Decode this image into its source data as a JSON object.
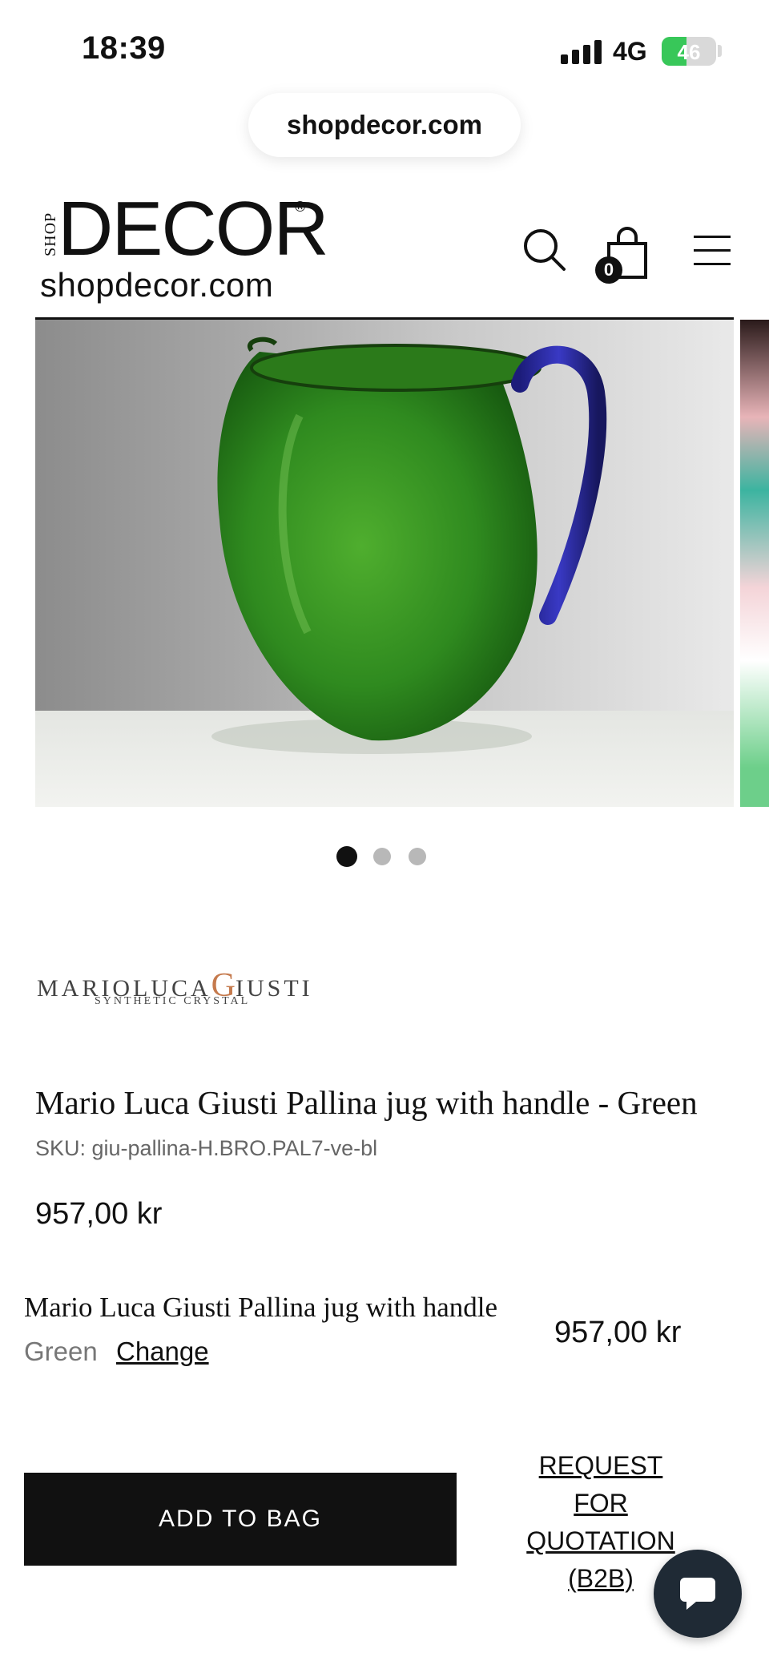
{
  "status_bar": {
    "time": "18:39",
    "network": "4G",
    "battery": "46",
    "battery_level": 0.46
  },
  "browser": {
    "url": "shopdecor.com"
  },
  "header": {
    "logo_shop": "SHOP",
    "logo_name": "DECOR",
    "logo_reg": "®",
    "logo_domain": "shopdecor.com",
    "bag_count": "0",
    "icons": [
      "search-icon",
      "bag-icon",
      "menu-icon"
    ]
  },
  "gallery": {
    "image_count": 3,
    "active_index": 0
  },
  "brand": {
    "main_part1": "MARIOLUCA",
    "main_g": "G",
    "main_part2": "IUSTI",
    "sub": "SYNTHETIC CRYSTAL",
    "accent_color": "#c57a4d"
  },
  "product": {
    "title": "Mario Luca Giusti Pallina jug with handle - Green",
    "sku": "SKU: giu-pallina-H.BRO.PAL7-ve-bl",
    "price": "957,00 kr"
  },
  "variant": {
    "name": "Mario Luca Giusti Pallina jug with handle",
    "color": "Green",
    "change_label": "Change",
    "price": "957,00 kr"
  },
  "actions": {
    "add_to_bag": "ADD TO BAG",
    "quote_lines": [
      "REQUEST",
      "FOR",
      "QUOTATION",
      "(B2B)"
    ]
  },
  "colors": {
    "button_bg": "#111111",
    "chat_bg": "#1f2a35",
    "jug_green": "#2f8a1f",
    "handle_blue": "#2a2a9c"
  }
}
